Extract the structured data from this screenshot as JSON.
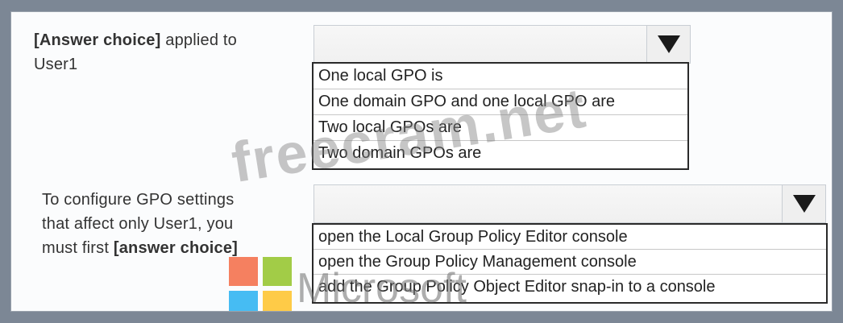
{
  "question1": {
    "prompt_bold": "[Answer choice]",
    "prompt_rest_line1": " applied to",
    "prompt_line2": "User1",
    "options": [
      "One local GPO is",
      "One domain GPO and one local GPO are",
      "Two local GPOs are",
      "Two domain GPOs are"
    ]
  },
  "question2": {
    "prompt_line1": "To configure GPO settings",
    "prompt_line2": "that affect only User1, you",
    "prompt_line3_prefix": "must first ",
    "prompt_bold": "[answer choice]",
    "options": [
      "open the Local Group Policy Editor console",
      "open the Group Policy Management console",
      "add the Group Policy Object Editor snap-in to a console"
    ]
  },
  "watermark": {
    "text": "freecram.net"
  },
  "logo": {
    "text": "Microsoft",
    "colors": [
      "#f25022",
      "#7fba00",
      "#00a4ef",
      "#ffb900"
    ]
  }
}
